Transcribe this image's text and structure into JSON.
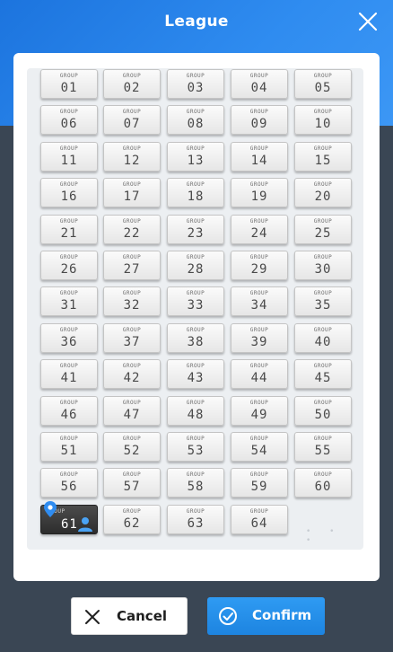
{
  "header": {
    "title": "League"
  },
  "tile_caption": "GROUP",
  "groups": [
    "01",
    "02",
    "03",
    "04",
    "05",
    "06",
    "07",
    "08",
    "09",
    "10",
    "11",
    "12",
    "13",
    "14",
    "15",
    "16",
    "17",
    "18",
    "19",
    "20",
    "21",
    "22",
    "23",
    "24",
    "25",
    "26",
    "27",
    "28",
    "29",
    "30",
    "31",
    "32",
    "33",
    "34",
    "35",
    "36",
    "37",
    "38",
    "39",
    "40",
    "41",
    "42",
    "43",
    "44",
    "45",
    "46",
    "47",
    "48",
    "49",
    "50",
    "51",
    "52",
    "53",
    "54",
    "55",
    "56",
    "57",
    "58",
    "59",
    "60",
    "61",
    "62",
    "63",
    "64"
  ],
  "selected_group": "61",
  "pagination_dots": "• • •",
  "footer": {
    "cancel_label": "Cancel",
    "confirm_label": "Confirm"
  },
  "colors": {
    "header_blue": "#2f8cf0",
    "confirm_blue": "#1d84e0",
    "selected_tile": "#333333"
  },
  "icons": {
    "close": "close-icon",
    "pin": "location-pin-icon",
    "user": "user-icon",
    "cancel": "x-icon",
    "confirm": "check-circle-icon"
  }
}
